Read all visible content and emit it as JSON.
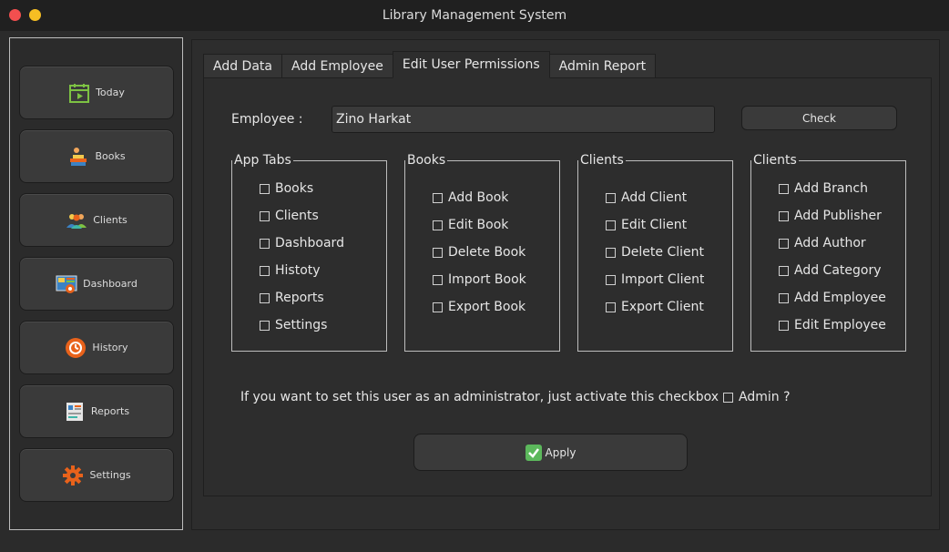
{
  "window": {
    "title": "Library Management System"
  },
  "sidebar": {
    "items": [
      {
        "label": "Today",
        "icon": "calendar-icon"
      },
      {
        "label": "Books",
        "icon": "books-icon"
      },
      {
        "label": "Clients",
        "icon": "users-icon"
      },
      {
        "label": "Dashboard",
        "icon": "dashboard-icon"
      },
      {
        "label": "History",
        "icon": "history-icon"
      },
      {
        "label": "Reports",
        "icon": "reports-icon"
      },
      {
        "label": "Settings",
        "icon": "gear-icon"
      }
    ]
  },
  "tabs": [
    {
      "label": "Add Data"
    },
    {
      "label": "Add Employee"
    },
    {
      "label": "Edit User Permissions",
      "active": true
    },
    {
      "label": "Admin Report"
    }
  ],
  "employee": {
    "label": "Employee :",
    "value": "Zino Harkat",
    "check_label": "Check"
  },
  "groups": [
    {
      "title": "App Tabs",
      "items": [
        "Books",
        "Clients",
        "Dashboard",
        "Histoty",
        "Reports",
        "Settings"
      ]
    },
    {
      "title": "Books",
      "items": [
        "Add Book",
        "Edit Book",
        "Delete Book",
        "Import Book",
        "Export Book"
      ]
    },
    {
      "title": "Clients",
      "items": [
        "Add Client",
        "Edit Client",
        "Delete Client",
        "Import Client",
        "Export Client"
      ]
    },
    {
      "title": "Clients",
      "items": [
        "Add Branch",
        "Add Publisher",
        "Add Author",
        "Add Category",
        "Add Employee",
        "Edit Employee"
      ]
    }
  ],
  "admin": {
    "text": "If you want to set this user as an administrator, just activate this checkbox :",
    "checkbox_label": "Admin ?"
  },
  "apply": {
    "label": "Apply"
  },
  "colors": {
    "accent_green": "#5cb85c",
    "close": "#f34f4f",
    "minimize": "#f6be23",
    "icon_orange": "#e8621b"
  }
}
